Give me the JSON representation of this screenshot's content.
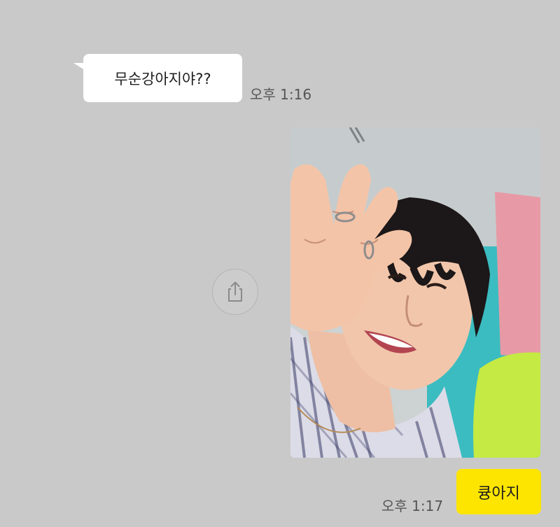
{
  "messages": [
    {
      "direction": "incoming",
      "type": "text",
      "text": "무순강아지야??",
      "time": "오후 1:16"
    },
    {
      "direction": "outgoing",
      "type": "image",
      "icon": "share-icon"
    },
    {
      "direction": "outgoing",
      "type": "text",
      "text": "큥아지",
      "time": "오후 1:17"
    }
  ],
  "colors": {
    "background": "#c9c9c9",
    "incoming_bubble": "#ffffff",
    "outgoing_bubble": "#fee500",
    "timestamp": "#555555"
  }
}
